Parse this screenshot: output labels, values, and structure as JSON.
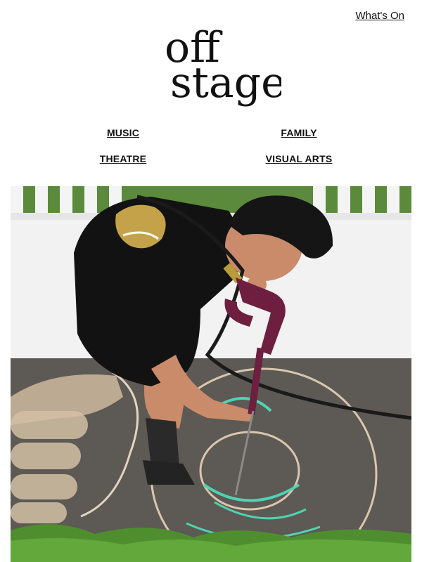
{
  "header": {
    "whats_on_label": "What's On"
  },
  "logo": {
    "line1": "off",
    "line2": "stage",
    "icon": "offstage-logo"
  },
  "nav": {
    "items": [
      {
        "label": "MUSIC"
      },
      {
        "label": "FAMILY"
      },
      {
        "label": "THEATRE"
      },
      {
        "label": "VISUAL ARTS"
      }
    ]
  },
  "hero": {
    "icon": "hero-image",
    "colors": {
      "wall": "#f2f2f2",
      "pavement": "#5d5955",
      "grass": "#4f8e2e",
      "shirt": "#121212",
      "pressure_washer": "#6e1f3f",
      "chalk_outline": "#d9c7ad",
      "chalk_teal": "#4fd3b2"
    }
  },
  "theme": {
    "text": "#111111",
    "background": "#ffffff"
  }
}
